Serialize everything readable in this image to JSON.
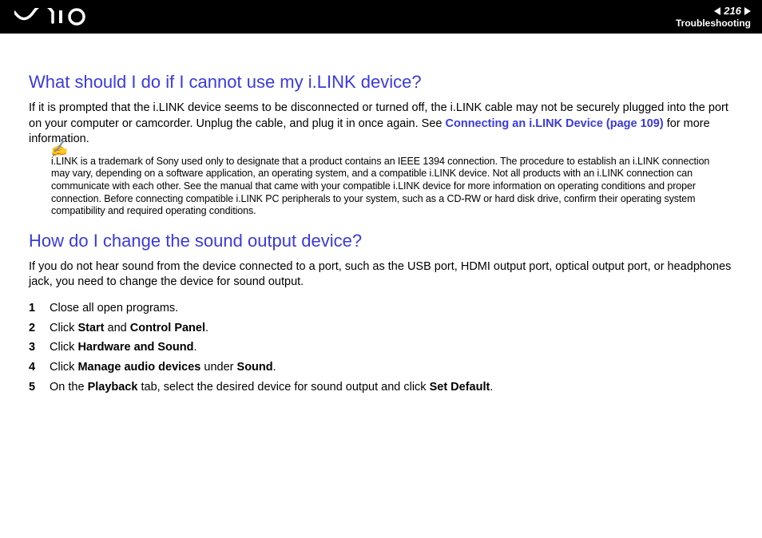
{
  "header": {
    "page_number": "216",
    "section": "Troubleshooting"
  },
  "q1": {
    "heading": "What should I do if I cannot use my i.LINK device?",
    "para_before_link": "If it is prompted that the i.LINK device seems to be disconnected or turned off, the i.LINK cable may not be securely plugged into the port on your computer or camcorder. Unplug the cable, and plug it in once again. See ",
    "link_text": "Connecting an i.LINK Device (page 109)",
    "para_after_link": " for more information.",
    "note": "i.LINK is a trademark of Sony used only to designate that a product contains an IEEE 1394 connection. The procedure to establish an i.LINK connection may vary, depending on a software application, an operating system, and a compatible i.LINK device. Not all products with an i.LINK connection can communicate with each other. See the manual that came with your compatible i.LINK device for more information on operating conditions and proper connection. Before connecting compatible i.LINK PC peripherals to your system, such as a CD-RW or hard disk drive, confirm their operating system compatibility and required operating conditions."
  },
  "q2": {
    "heading": "How do I change the sound output device?",
    "intro": "If you do not hear sound from the device connected to a port, such as the USB port, HDMI output port, optical output port, or headphones jack, you need to change the device for sound output.",
    "steps": [
      {
        "n": "1",
        "pre": "Close all open programs."
      },
      {
        "n": "2",
        "pre": "Click ",
        "b1": "Start",
        "mid": " and ",
        "b2": "Control Panel",
        "post": "."
      },
      {
        "n": "3",
        "pre": "Click ",
        "b1": "Hardware and Sound",
        "post": "."
      },
      {
        "n": "4",
        "pre": "Click ",
        "b1": "Manage audio devices",
        "mid": " under ",
        "b2": "Sound",
        "post": "."
      },
      {
        "n": "5",
        "pre": "On the ",
        "b1": "Playback",
        "mid": " tab, select the desired device for sound output and click ",
        "b2": "Set Default",
        "post": "."
      }
    ]
  }
}
